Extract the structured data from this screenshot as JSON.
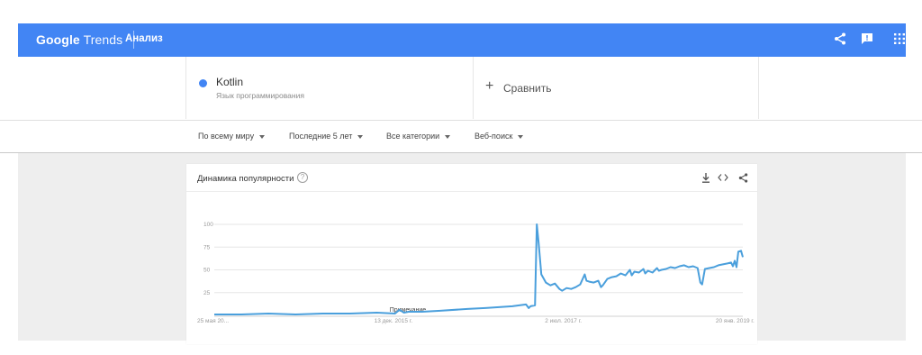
{
  "topbar": {
    "brand_google": "Google",
    "brand_trends": "Trends",
    "section": "Анализ",
    "icons": [
      "menu-icon",
      "share-icon",
      "feedback-icon",
      "apps-icon"
    ]
  },
  "term": {
    "name": "Kotlin",
    "category": "Язык программирования",
    "color": "#4285f4"
  },
  "compare": {
    "plus": "+",
    "label": "Сравнить"
  },
  "filters": {
    "region": "По всему миру",
    "period": "Последние 5 лет",
    "category": "Все категории",
    "search_type": "Веб-поиск"
  },
  "card": {
    "title": "Динамика популярности",
    "help": "?",
    "actions": [
      "download-icon",
      "embed-icon",
      "share-icon"
    ]
  },
  "chart_data": {
    "type": "line",
    "series": [
      {
        "name": "Kotlin",
        "color": "#4a9fdc",
        "points": [
          [
            0,
            1
          ],
          [
            30,
            1
          ],
          [
            60,
            2
          ],
          [
            90,
            1
          ],
          [
            120,
            2
          ],
          [
            150,
            2
          ],
          [
            180,
            3
          ],
          [
            200,
            2
          ],
          [
            205,
            6
          ],
          [
            210,
            3
          ],
          [
            215,
            4
          ],
          [
            230,
            4
          ],
          [
            250,
            5
          ],
          [
            280,
            7
          ],
          [
            300,
            8
          ],
          [
            330,
            10
          ],
          [
            345,
            12
          ],
          [
            348,
            8
          ],
          [
            350,
            10
          ],
          [
            355,
            11
          ],
          [
            357,
            100
          ],
          [
            359,
            80
          ],
          [
            362,
            45
          ],
          [
            367,
            36
          ],
          [
            372,
            33
          ],
          [
            377,
            35
          ],
          [
            382,
            29
          ],
          [
            385,
            27
          ],
          [
            390,
            30
          ],
          [
            395,
            29
          ],
          [
            400,
            31
          ],
          [
            405,
            34
          ],
          [
            410,
            45
          ],
          [
            412,
            38
          ],
          [
            415,
            37
          ],
          [
            420,
            36
          ],
          [
            425,
            38
          ],
          [
            428,
            31
          ],
          [
            430,
            33
          ],
          [
            435,
            40
          ],
          [
            440,
            42
          ],
          [
            445,
            43
          ],
          [
            450,
            46
          ],
          [
            455,
            44
          ],
          [
            460,
            50
          ],
          [
            462,
            44
          ],
          [
            465,
            48
          ],
          [
            470,
            47
          ],
          [
            475,
            51
          ],
          [
            477,
            46
          ],
          [
            480,
            49
          ],
          [
            485,
            47
          ],
          [
            490,
            52
          ],
          [
            492,
            49
          ],
          [
            495,
            50
          ],
          [
            500,
            51
          ],
          [
            505,
            53
          ],
          [
            510,
            52
          ],
          [
            515,
            54
          ],
          [
            520,
            55
          ],
          [
            525,
            53
          ],
          [
            530,
            54
          ],
          [
            535,
            52
          ],
          [
            538,
            36
          ],
          [
            540,
            34
          ],
          [
            543,
            51
          ],
          [
            548,
            52
          ],
          [
            553,
            53
          ],
          [
            558,
            55
          ],
          [
            563,
            56
          ],
          [
            568,
            57
          ],
          [
            572,
            58
          ],
          [
            574,
            54
          ],
          [
            576,
            60
          ],
          [
            578,
            53
          ],
          [
            580,
            70
          ],
          [
            583,
            71
          ],
          [
            585,
            64
          ]
        ]
      }
    ],
    "y_ticks": [
      "100",
      "75",
      "50",
      "25"
    ],
    "y_tick_values": [
      100,
      75,
      50,
      25
    ],
    "x_ticks": [
      {
        "label": "25 мая 20...",
        "x": 0
      },
      {
        "label": "13 дек. 2015 г.",
        "x": 177
      },
      {
        "label": "2 июл. 2017 г.",
        "x": 366
      },
      {
        "label": "20 янв. 2019 г.",
        "x": 555
      }
    ],
    "annotation": {
      "label": "Примечание",
      "x": 204
    },
    "ylim": [
      0,
      100
    ],
    "xlim": [
      0,
      585
    ],
    "grid": true
  }
}
